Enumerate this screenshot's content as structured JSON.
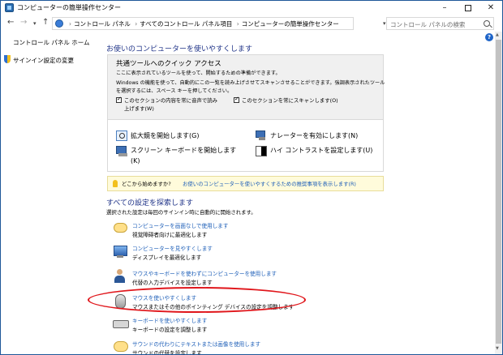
{
  "window": {
    "title": "コンピューターの簡単操作センター"
  },
  "address": {
    "crumbs": [
      "コントロール パネル",
      "すべてのコントロール パネル項目",
      "コンピューターの簡単操作センター"
    ],
    "search_placeholder": "コントロール パネルの検索"
  },
  "sidebar": {
    "home": "コントロール パネル ホーム",
    "signin": "サインイン設定の変更"
  },
  "main": {
    "heading": "お使いのコンピューターを使いやすくします",
    "quick_access": {
      "title": "共通ツールへのクイック アクセス",
      "desc1": "ここに表示されているツールを使って、開始するための準備ができます。",
      "desc2": "Windows の機能を使って、自動的にこの一覧を読み上げさせてスキャンさせることができます。強調表示されたツール",
      "desc3": "を選択するには、スペース キーを押してください。",
      "cb1_line1": "このセクションの内容を常に音声で読み",
      "cb1_line2": "上げます(W)",
      "cb2": "このセクションを常にスキャンします(O)",
      "items": [
        "拡大鏡を開始します(G)",
        "ナレーターを有効にします(N)",
        "スクリーン キーボードを開始します",
        "ハイ コントラストを設定します(U)"
      ],
      "item3_line2": "(K)"
    },
    "tip": {
      "question": "どこから始めますか?",
      "link": "お使いのコンピューターを使いやすくするための推奨事項を表示します(R)"
    },
    "explore": {
      "heading": "すべての設定を探索します",
      "desc": "選択された設定は毎回のサインイン時に自動的に開始されます。",
      "rows": [
        {
          "link": "コンピューターを画面なしで使用します",
          "desc": "視覚障碍者向けに最適化します"
        },
        {
          "link": "コンピューターを見やすくします",
          "desc": "ディスプレイを最適化します"
        },
        {
          "link": "マウスやキーボードを使わずにコンピューターを使用します",
          "desc": "代替の入力デバイスを設定します"
        },
        {
          "link": "マウスを使いやすくします",
          "desc": "マウスまたはその他のポインティング デバイスの設定を調整します"
        },
        {
          "link": "キーボードを使いやすくします",
          "desc": "キーボードの設定を調整します"
        },
        {
          "link": "サウンドの代わりにテキストまたは画像を使用します",
          "desc": "サウンドの代替を設定します"
        }
      ]
    }
  },
  "colors": {
    "heading": "#1e3287",
    "link": "#1e5fb8",
    "annotation": "#e0161b"
  }
}
